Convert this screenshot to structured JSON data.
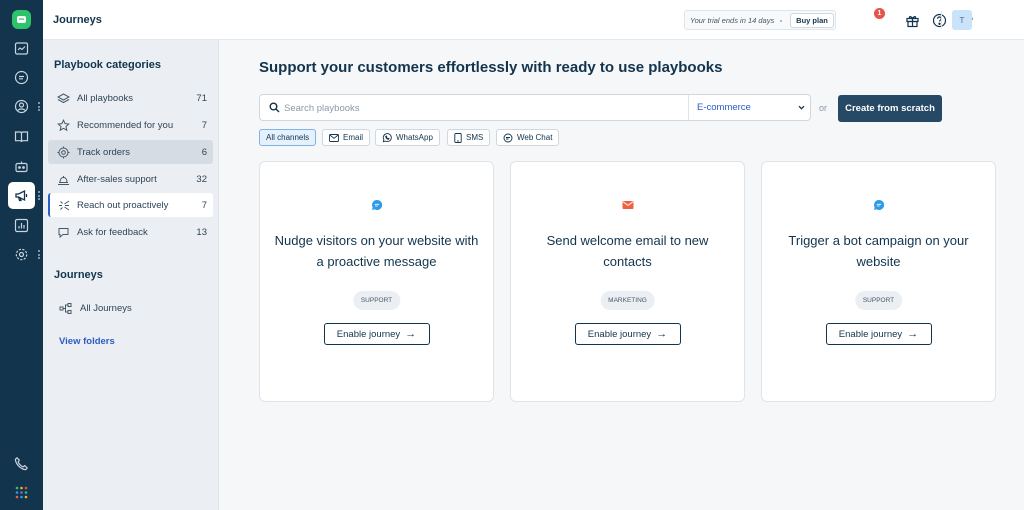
{
  "header": {
    "title": "Journeys",
    "trial_text": "Your trial ends in 14 days",
    "buy_label": "Buy plan",
    "notification_count": "1",
    "avatar_initial": "T"
  },
  "sidebar": {
    "categories_heading": "Playbook categories",
    "categories": [
      {
        "label": "All playbooks",
        "count": "71",
        "icon": "layers-icon"
      },
      {
        "label": "Recommended for you",
        "count": "7",
        "icon": "star-icon"
      },
      {
        "label": "Track orders",
        "count": "6",
        "icon": "target-icon"
      },
      {
        "label": "After-sales support",
        "count": "32",
        "icon": "bell-icon"
      },
      {
        "label": "Reach out proactively",
        "count": "7",
        "icon": "sparkle-icon"
      },
      {
        "label": "Ask for feedback",
        "count": "13",
        "icon": "feedback-icon"
      }
    ],
    "journeys_heading": "Journeys",
    "all_journeys_label": "All Journeys",
    "view_folders_label": "View folders"
  },
  "main": {
    "title": "Support your customers effortlessly with ready to use playbooks",
    "search_placeholder": "Search playbooks",
    "industry_select": "E-commerce",
    "or_label": "or",
    "create_label": "Create from scratch",
    "channels": [
      {
        "label": "All channels"
      },
      {
        "label": "Email"
      },
      {
        "label": "WhatsApp"
      },
      {
        "label": "SMS"
      },
      {
        "label": "Web Chat"
      }
    ],
    "cards": [
      {
        "title": "Nudge visitors on your website with a proactive message",
        "tag": "SUPPORT",
        "button": "Enable journey",
        "icon": "chat-bubble-icon",
        "icon_color": "#2c9be8"
      },
      {
        "title": "Send welcome email to new contacts",
        "tag": "MARKETING",
        "button": "Enable journey",
        "icon": "envelope-icon",
        "icon_color": "#f0613f"
      },
      {
        "title": "Trigger a bot campaign on your website",
        "tag": "SUPPORT",
        "button": "Enable journey",
        "icon": "chat-bubble-icon",
        "icon_color": "#2c9be8"
      }
    ],
    "arrow_glyph": "→"
  },
  "colors": {
    "rail": "#12344d",
    "primary_button": "#264966",
    "link": "#2c5cc5",
    "badge": "#e5534b",
    "logo": "#2ec26a"
  }
}
